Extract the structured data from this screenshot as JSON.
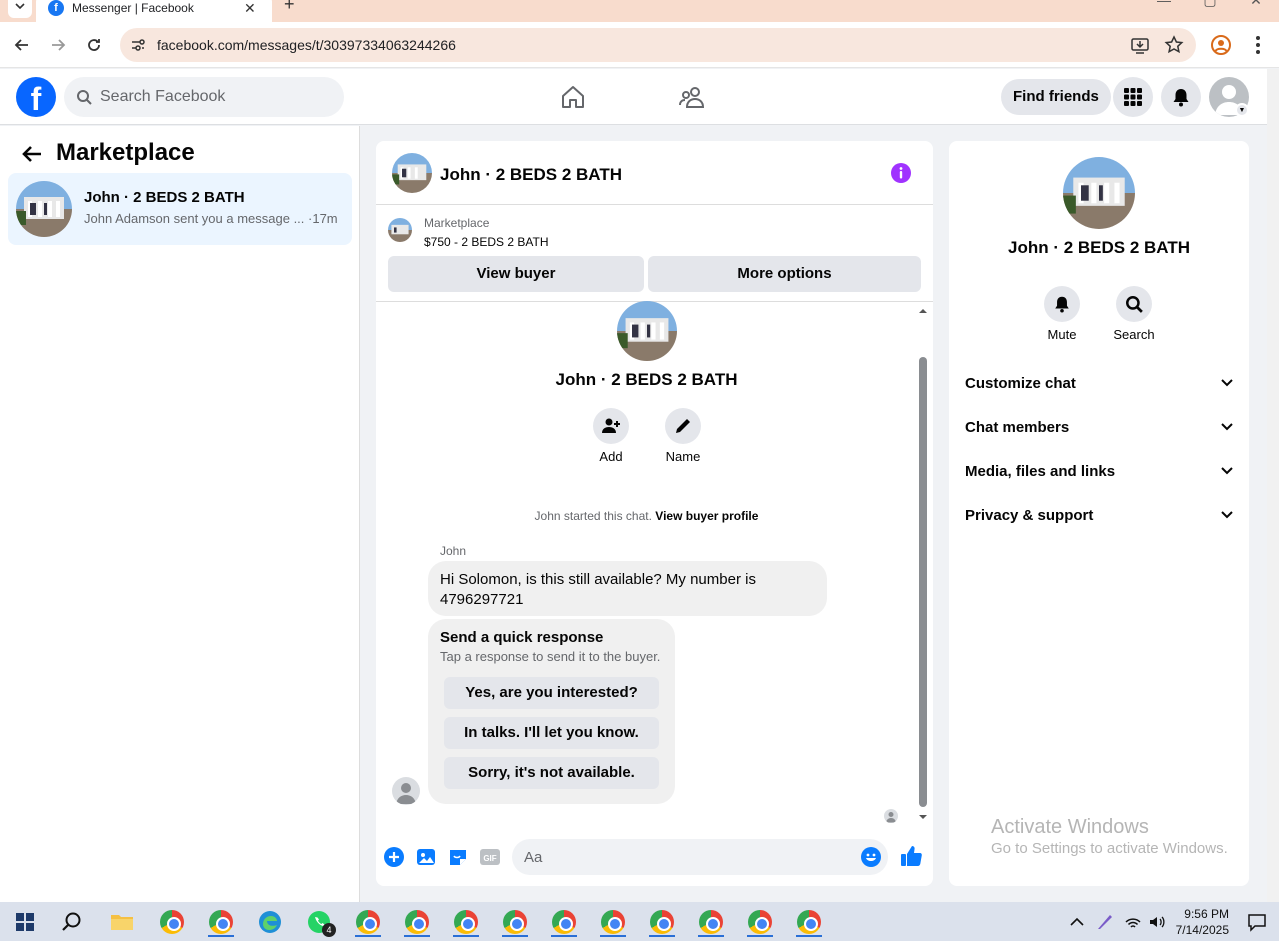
{
  "browser": {
    "tab_title": "Messenger | Facebook",
    "url": "facebook.com/messages/t/30397334063244266",
    "new_tab": "+",
    "close": "✕"
  },
  "header": {
    "search_placeholder": "Search Facebook",
    "find_friends": "Find friends"
  },
  "left": {
    "title": "Marketplace",
    "conversation": {
      "name": "John · 2 BEDS 2 BATH",
      "preview": "John Adamson sent you a message ... ·17m"
    }
  },
  "chat": {
    "title": "John · 2 BEDS 2 BATH",
    "listing": {
      "source": "Marketplace",
      "price_title": "$750 - 2 BEDS 2 BATH"
    },
    "view_buyer": "View buyer",
    "more_options": "More options",
    "profile_name": "John · 2 BEDS 2 BATH",
    "add_label": "Add",
    "name_label": "Name",
    "started_text": "John started this chat.",
    "view_buyer_profile": "View buyer profile",
    "sender": "John",
    "message": "Hi Solomon, is this still available? My number is 4796297721",
    "quick": {
      "title": "Send a quick response",
      "subtitle": "Tap a response to send it to the buyer.",
      "options": [
        "Yes, are you interested?",
        "In talks. I'll let you know.",
        "Sorry, it's not available."
      ]
    },
    "composer_placeholder": "Aa"
  },
  "right": {
    "name": "John · 2 BEDS 2 BATH",
    "mute": "Mute",
    "search": "Search",
    "sections": [
      "Customize chat",
      "Chat members",
      "Media, files and links",
      "Privacy & support"
    ],
    "watermark_title": "Activate Windows",
    "watermark_sub": "Go to Settings to activate Windows."
  },
  "taskbar": {
    "time": "9:56 PM",
    "date": "7/14/2025",
    "whatsapp_badge": "4"
  },
  "colors": {
    "fb_blue": "#0866ff",
    "messenger_blue": "#0a7cff",
    "selected_bg": "#ebf5ff",
    "tab_strip": "#f8dccd"
  }
}
